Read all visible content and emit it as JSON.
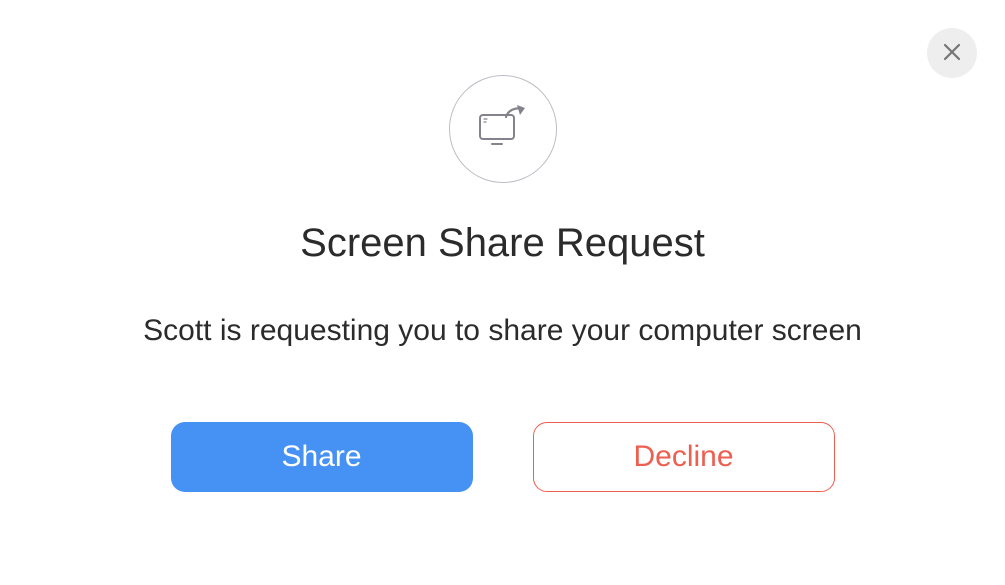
{
  "dialog": {
    "title": "Screen Share Request",
    "message": "Scott is requesting you to share your computer screen",
    "share_label": "Share",
    "decline_label": "Decline"
  }
}
